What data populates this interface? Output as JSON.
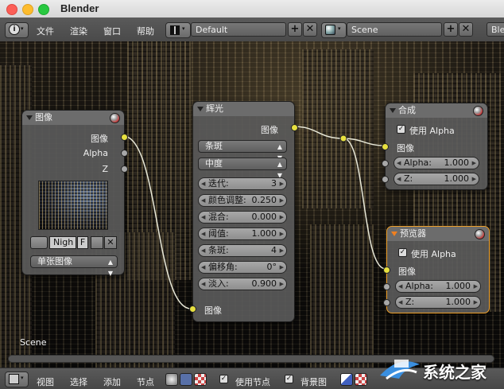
{
  "app": {
    "title": "Blender"
  },
  "header": {
    "menus": [
      "文件",
      "渲染",
      "窗口",
      "帮助"
    ],
    "layout_name": "Default",
    "scene_name": "Scene",
    "engine_partial": "Blen"
  },
  "nodes": {
    "image": {
      "title": "图像",
      "out_image": "图像",
      "out_alpha": "Alpha",
      "out_z": "Z",
      "image_name": "Nigh",
      "fake_user": "F",
      "source": "单张图像"
    },
    "glare": {
      "title": "辉光",
      "out_image": "图像",
      "type": "条斑",
      "quality": "中度",
      "params": [
        {
          "label": "迭代:",
          "value": "3"
        },
        {
          "label": "颜色调整:",
          "value": "0.250"
        },
        {
          "label": "混合:",
          "value": "0.000"
        },
        {
          "label": "阈值:",
          "value": "1.000"
        },
        {
          "label": "条斑:",
          "value": "4"
        },
        {
          "label": "偏移角:",
          "value": "0°"
        },
        {
          "label": "淡入:",
          "value": "0.900"
        }
      ],
      "in_image": "图像"
    },
    "composite": {
      "title": "合成",
      "use_alpha": "使用 Alpha",
      "in_image": "图像",
      "alpha_label": "Alpha:",
      "alpha_value": "1.000",
      "z_label": "Z:",
      "z_value": "1.000"
    },
    "viewer": {
      "title": "预览器",
      "use_alpha": "使用 Alpha",
      "in_image": "图像",
      "alpha_label": "Alpha:",
      "alpha_value": "1.000",
      "z_label": "Z:",
      "z_value": "1.000"
    }
  },
  "viewport": {
    "scene_label": "Scene"
  },
  "footer": {
    "menus": [
      "视图",
      "选择",
      "添加",
      "节点"
    ],
    "use_nodes": "使用节点",
    "backdrop": "背景图"
  },
  "watermark": {
    "text": "系统之家"
  },
  "colors": {
    "socket_image": "#e7e040",
    "socket_value": "#a8a8a8",
    "selected_border": "#f0a028"
  }
}
